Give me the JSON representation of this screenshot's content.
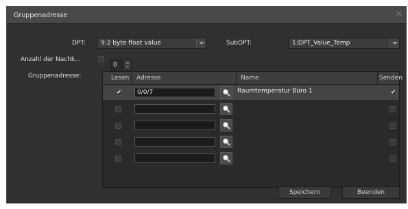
{
  "dialog": {
    "title": "Gruppenadresse",
    "close_glyph": "×"
  },
  "form": {
    "dpt_label": "DPT:",
    "dpt_value": "9:2 byte float value",
    "subdpt_label": "SubDPT:",
    "subdpt_value": "1:DPT_Value_Temp",
    "anzahl_label": "Anzahl der Nachk...",
    "anzahl_checked": false,
    "anzahl_value": "0",
    "gruppenadresse_label": "Gruppenadresse:"
  },
  "table": {
    "columns": [
      "Lesen",
      "Adresse",
      "Name",
      "Senden"
    ],
    "rows": [
      {
        "lesen": true,
        "adresse": "0/0/7",
        "name": "Raumtemperatur Büro 1",
        "senden": true
      },
      {
        "lesen": false,
        "adresse": "",
        "name": "",
        "senden": false
      },
      {
        "lesen": false,
        "adresse": "",
        "name": "",
        "senden": false
      },
      {
        "lesen": false,
        "adresse": "",
        "name": "",
        "senden": false
      },
      {
        "lesen": false,
        "adresse": "",
        "name": "",
        "senden": false
      }
    ]
  },
  "icons": {
    "check": "✔",
    "search": "search-icon",
    "dropdown": "chevron-down-icon"
  },
  "buttons": {
    "save_label": "Speichern",
    "close_label": "Beenden"
  },
  "colors": {
    "dialog_bg": "#303030",
    "titlebar_bg": "#484848",
    "selected_row_bg": "#444444"
  }
}
